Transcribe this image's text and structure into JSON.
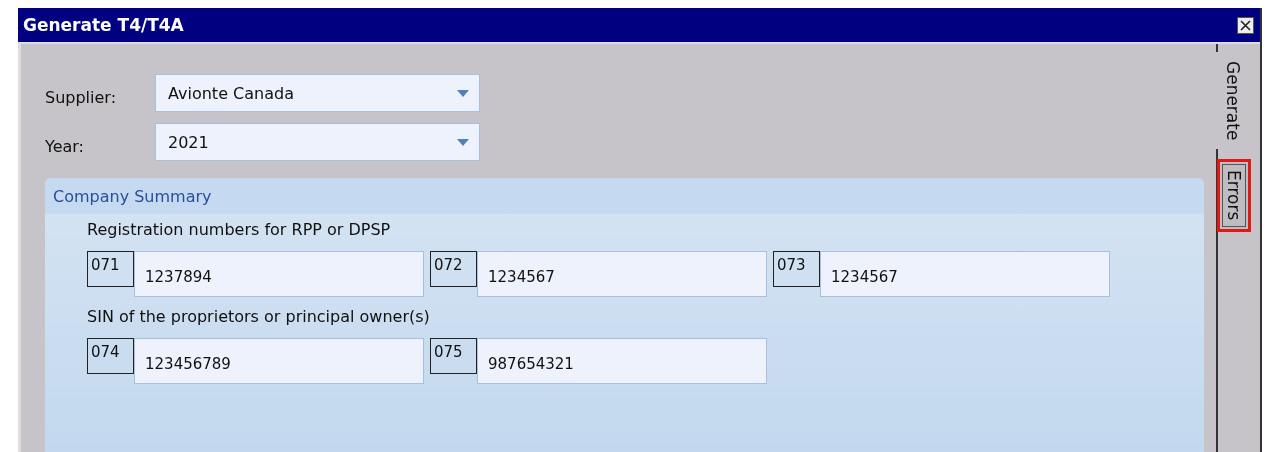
{
  "window": {
    "title": "Generate T4/T4A"
  },
  "selectors": [
    {
      "label": "Supplier:",
      "value": "Avionte Canada"
    },
    {
      "label": "Year:",
      "value": "2021"
    }
  ],
  "company_summary": {
    "title": "Company Summary",
    "groups": [
      {
        "heading": "Registration numbers for RPP or DPSP",
        "fields": [
          {
            "code": "071",
            "value": "1237894"
          },
          {
            "code": "072",
            "value": "1234567"
          },
          {
            "code": "073",
            "value": "1234567"
          }
        ]
      },
      {
        "heading": "SIN of the proprietors or principal owner(s)",
        "fields": [
          {
            "code": "074",
            "value": "123456789"
          },
          {
            "code": "075",
            "value": "987654321"
          }
        ]
      }
    ]
  },
  "tabs": [
    {
      "label": "Generate",
      "selected": true,
      "highlighted": false
    },
    {
      "label": "Errors",
      "selected": false,
      "highlighted": true
    }
  ]
}
